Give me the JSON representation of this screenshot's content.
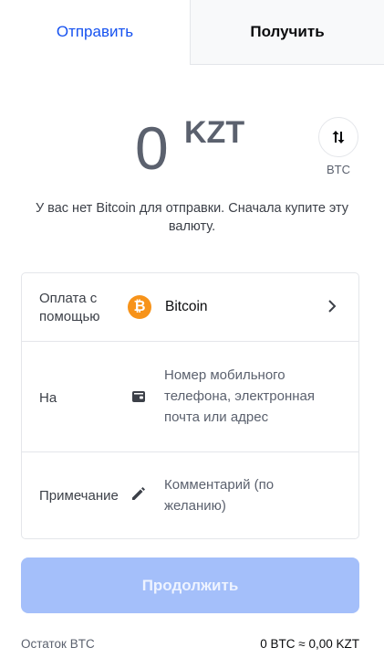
{
  "tabs": {
    "send": "Отправить",
    "receive": "Получить"
  },
  "amount": {
    "value": "0",
    "currency": "KZT"
  },
  "swap": {
    "label": "BTC",
    "icon": "swap-vertical-icon"
  },
  "notice": "У вас нет Bitcoin для отправки. Сначала купите эту валюту.",
  "form": {
    "pay_with": {
      "label": "Оплата с помощью",
      "asset": "Bitcoin",
      "asset_symbol": "₿"
    },
    "to": {
      "label": "На",
      "placeholder": "Номер мобильного телефона, электронная почта или адрес"
    },
    "note": {
      "label": "Примечание",
      "placeholder": "Комментарий (по желанию)"
    }
  },
  "continue_label": "Продолжить",
  "balance": {
    "label": "Остаток BTC",
    "value": "0 BTC ≈ 0,00 KZT"
  },
  "colors": {
    "accent": "#1652f0",
    "bitcoin": "#f7931a",
    "button_disabled": "#a4bffa"
  }
}
